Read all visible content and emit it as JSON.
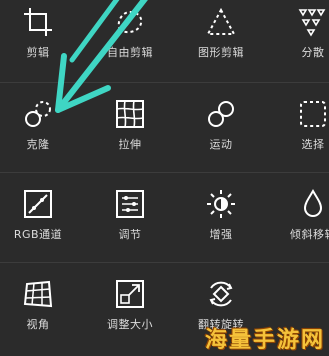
{
  "tools": [
    {
      "id": "crop",
      "label": "剪辑",
      "icon": "crop-icon"
    },
    {
      "id": "freecut",
      "label": "自由剪辑",
      "icon": "freeform-cut-icon"
    },
    {
      "id": "shapecut",
      "label": "图形剪辑",
      "icon": "shape-cut-icon"
    },
    {
      "id": "split",
      "label": "分散",
      "icon": "scatter-icon"
    },
    {
      "id": "clone",
      "label": "克隆",
      "icon": "clone-icon"
    },
    {
      "id": "warp",
      "label": "拉伸",
      "icon": "warp-icon"
    },
    {
      "id": "motion",
      "label": "运动",
      "icon": "motion-icon"
    },
    {
      "id": "select",
      "label": "选择",
      "icon": "select-icon"
    },
    {
      "id": "rgb",
      "label": "RGB通道",
      "icon": "rgb-curve-icon"
    },
    {
      "id": "adjust",
      "label": "调节",
      "icon": "adjust-icon"
    },
    {
      "id": "enhance",
      "label": "增强",
      "icon": "enhance-icon"
    },
    {
      "id": "tilt",
      "label": "倾斜移轴",
      "icon": "tilt-shift-icon"
    },
    {
      "id": "perspective",
      "label": "视角",
      "icon": "perspective-icon"
    },
    {
      "id": "resize",
      "label": "调整大小",
      "icon": "resize-icon"
    },
    {
      "id": "flip",
      "label": "翻转旋转",
      "icon": "flip-rotate-icon"
    }
  ],
  "watermark": "海量手游网",
  "colors": {
    "background": "#2b2b2b",
    "icon": "#ffffff",
    "arrow": "#3fd6c4",
    "watermark": "#f5c23a"
  }
}
